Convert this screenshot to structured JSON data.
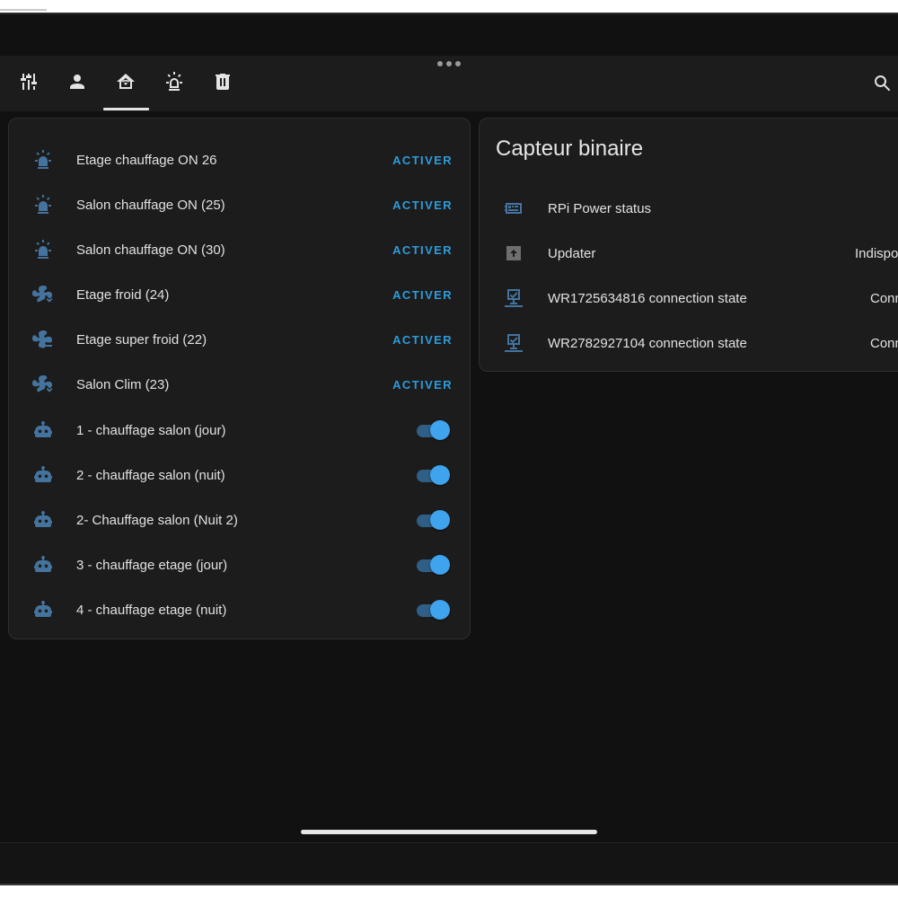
{
  "toolbar": {
    "tabs": [
      {
        "icon": "tune-vertical-icon",
        "active": false
      },
      {
        "icon": "account-icon",
        "active": false
      },
      {
        "icon": "home-automation-icon",
        "active": true
      },
      {
        "icon": "alarm-light-icon",
        "active": false
      },
      {
        "icon": "trash-can-icon",
        "active": false
      }
    ],
    "overflow_icon": "dots-horizontal-icon",
    "search_icon": "magnify-icon"
  },
  "left_card": {
    "rows": [
      {
        "icon": "alarm-light-icon",
        "name": "Etage chauffage ON 26",
        "action": "ACTIVER"
      },
      {
        "icon": "alarm-light-icon",
        "name": "Salon chauffage ON (25)",
        "action": "ACTIVER"
      },
      {
        "icon": "alarm-light-icon",
        "name": "Salon chauffage ON (30)",
        "action": "ACTIVER"
      },
      {
        "icon": "fan-chevron-down-icon",
        "name": "Etage froid (24)",
        "action": "ACTIVER"
      },
      {
        "icon": "fan-minus-icon",
        "name": "Etage super froid (22)",
        "action": "ACTIVER"
      },
      {
        "icon": "fan-chevron-down-icon",
        "name": "Salon Clim (23)",
        "action": "ACTIVER"
      },
      {
        "icon": "robot-icon",
        "name": "1 - chauffage salon (jour)",
        "toggle": true
      },
      {
        "icon": "robot-icon",
        "name": "2 - chauffage salon (nuit)",
        "toggle": true
      },
      {
        "icon": "robot-icon",
        "name": "2- Chauffage salon (Nuit 2)",
        "toggle": true
      },
      {
        "icon": "robot-icon",
        "name": "3 - chauffage etage (jour)",
        "toggle": true
      },
      {
        "icon": "robot-icon",
        "name": "4 - chauffage etage (nuit)",
        "toggle": true
      }
    ]
  },
  "right_card": {
    "title": "Capteur binaire",
    "rows": [
      {
        "icon": "raspberry-pi-board-icon",
        "name": "RPi Power status",
        "state": ""
      },
      {
        "icon": "package-up-icon",
        "name": "Updater",
        "state": "Indispo"
      },
      {
        "icon": "lan-connect-icon",
        "name": "WR1725634816 connection state",
        "state": "Conn"
      },
      {
        "icon": "lan-connect-icon",
        "name": "WR2782927104 connection state",
        "state": "Conn"
      }
    ]
  },
  "colors": {
    "background": "#111111",
    "card": "#1c1c1c",
    "icon": "#44739e",
    "accent": "#2d9cdb",
    "toggle_on": "#3fa3ee"
  }
}
